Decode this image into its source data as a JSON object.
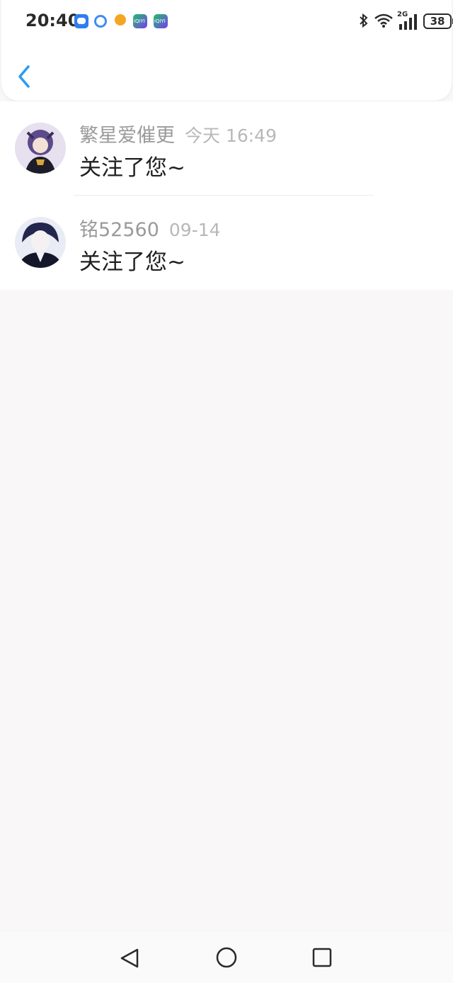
{
  "status_bar": {
    "time": "20:40",
    "network_label": "2G",
    "battery_level": "38",
    "notification_icons": [
      "message-icon",
      "browser-icon",
      "taobao-icon",
      "iqiyi-icon",
      "iqiyi-icon"
    ],
    "iqiyi_label": "iQIYI"
  },
  "header": {
    "back_icon": "chevron-left-icon",
    "accent_color": "#2b9af3"
  },
  "notifications": [
    {
      "user": "繁星爱催更",
      "time": "今天 16:49",
      "message": "关注了您~"
    },
    {
      "user": "铭52560",
      "time": "09-14",
      "message": "关注了您~"
    }
  ],
  "nav_bar": {
    "back_icon": "triangle-back-icon",
    "home_icon": "circle-home-icon",
    "recents_icon": "square-recents-icon"
  }
}
